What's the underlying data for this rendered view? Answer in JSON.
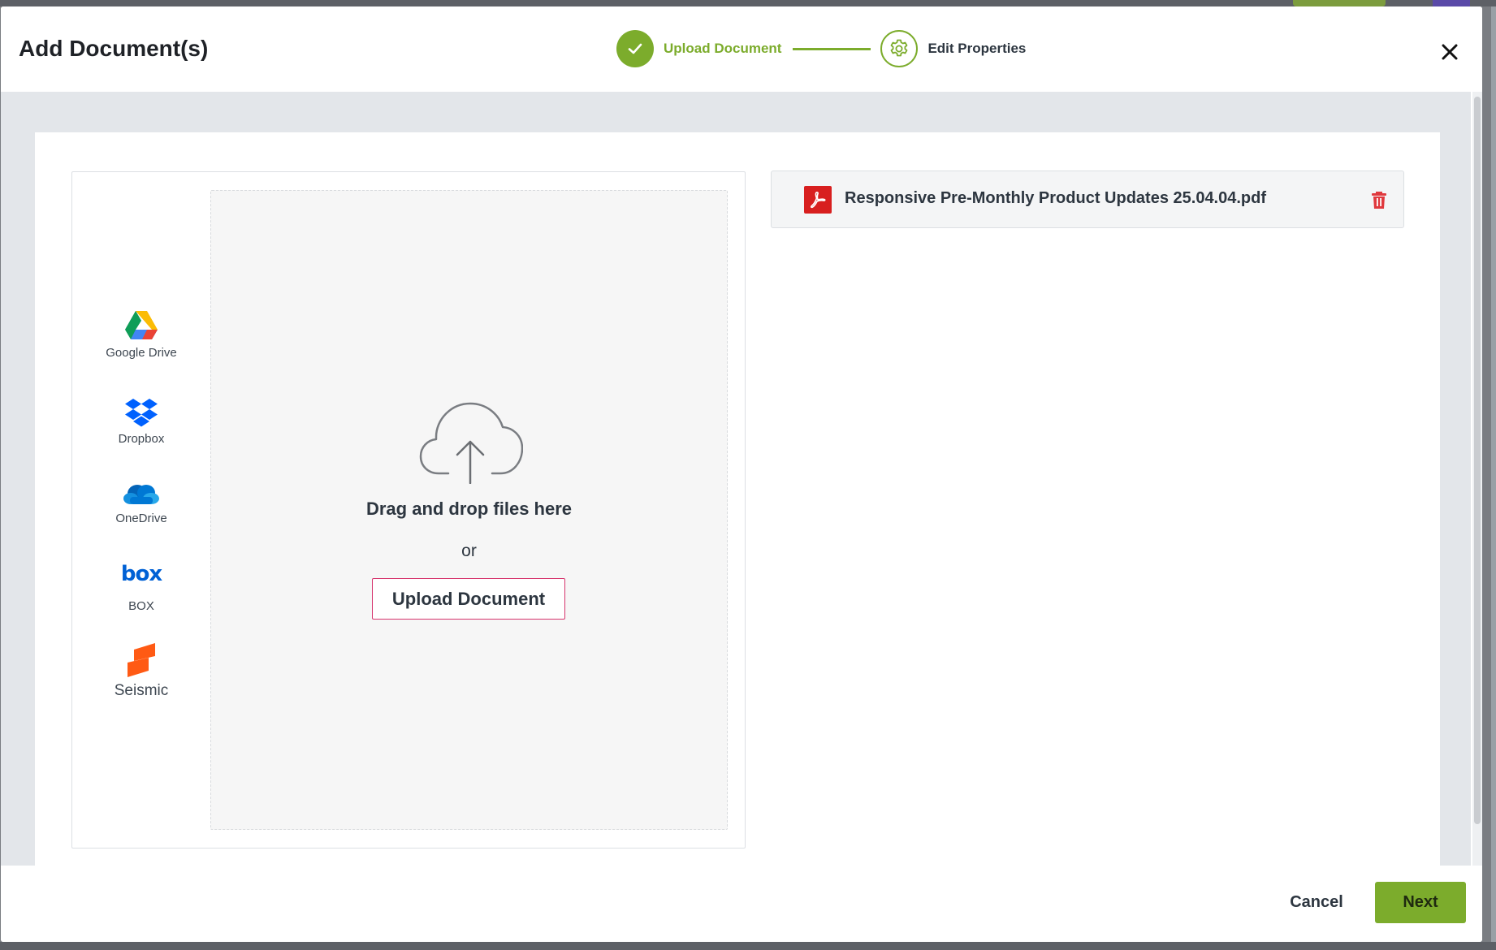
{
  "modal": {
    "title": "Add Document(s)",
    "close_icon": "close-icon"
  },
  "stepper": {
    "steps": [
      {
        "label": "Upload Document",
        "state": "completed",
        "icon": "check-icon"
      },
      {
        "label": "Edit Properties",
        "state": "pending",
        "icon": "gear-icon"
      }
    ]
  },
  "sources": [
    {
      "label": "Google Drive",
      "icon": "google-drive-icon"
    },
    {
      "label": "Dropbox",
      "icon": "dropbox-icon"
    },
    {
      "label": "OneDrive",
      "icon": "onedrive-icon"
    },
    {
      "label": "BOX",
      "icon": "box-icon",
      "logo_text": "box"
    },
    {
      "label": "Seismic",
      "icon": "seismic-icon"
    }
  ],
  "dropzone": {
    "icon": "cloud-upload-icon",
    "text": "Drag and drop files here",
    "or": "or",
    "button_label": "Upload Document"
  },
  "files": [
    {
      "name": "Responsive Pre-Monthly Product Updates 25.04.04.pdf",
      "icon": "pdf-icon",
      "delete_icon": "trash-icon"
    }
  ],
  "footer": {
    "cancel_label": "Cancel",
    "next_label": "Next"
  },
  "colors": {
    "accent": "#7cac2c",
    "upload_button_border": "#d6336c",
    "pdf_red": "#d81f1f",
    "delete_red": "#e0393e"
  }
}
